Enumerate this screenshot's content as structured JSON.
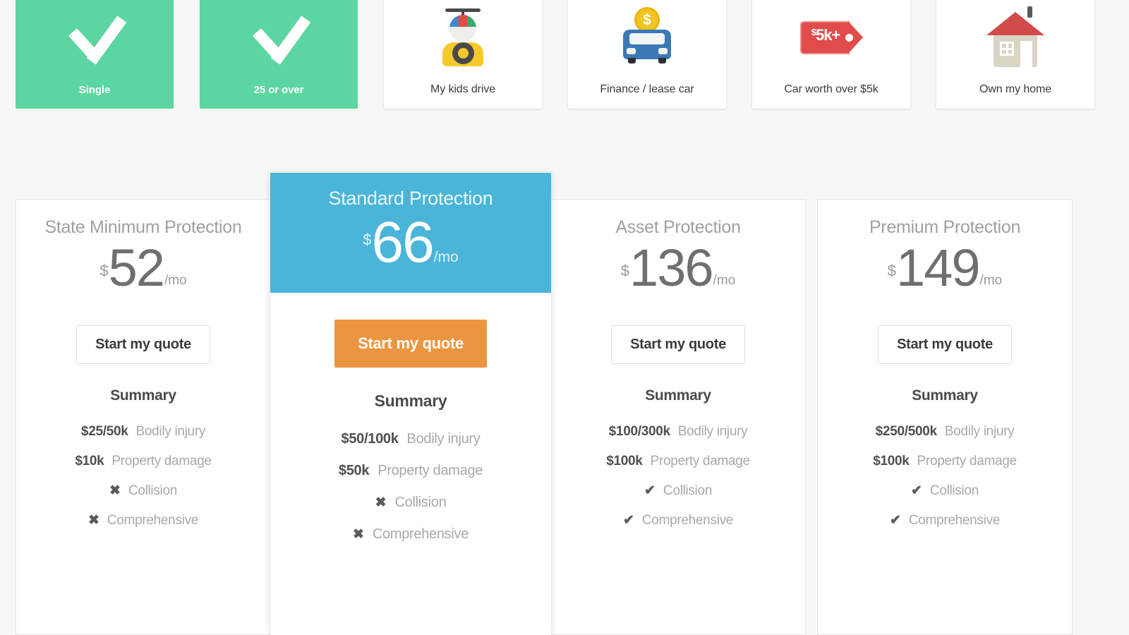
{
  "profile_tiles": [
    {
      "label": "Single",
      "icon": "check-icon",
      "selected": true
    },
    {
      "label": "25 or over",
      "icon": "check-icon",
      "selected": true
    },
    {
      "label": "My kids drive",
      "icon": "kid-driver-icon",
      "selected": false
    },
    {
      "label": "Finance / lease car",
      "icon": "financed-car-icon",
      "selected": false
    },
    {
      "label": "Car worth over $5k",
      "icon": "price-tag-5k-icon",
      "selected": false
    },
    {
      "label": "Own my home",
      "icon": "house-icon",
      "selected": false
    }
  ],
  "tag_icon_text": {
    "sup": "$",
    "main": "5k+"
  },
  "coin_symbol": "$",
  "currency_symbol": "$",
  "per_month": "/mo",
  "summary_heading": "Summary",
  "cta_label": "Start my quote",
  "glyphs": {
    "included": "✔",
    "excluded": "✖"
  },
  "colors": {
    "selected_tile": "#5bd6a0",
    "featured_header": "#4ab5d8",
    "primary_cta": "#ec9540",
    "page_background": "#f7f7f7"
  },
  "plans": [
    {
      "name": "State Minimum Protection",
      "price": "52",
      "featured": false,
      "summary": [
        {
          "value": "$25/50k",
          "label": "Bodily injury"
        },
        {
          "value": "$10k",
          "label": "Property damage"
        },
        {
          "value": "✖",
          "label": "Collision"
        },
        {
          "value": "✖",
          "label": "Comprehensive"
        }
      ]
    },
    {
      "name": "Standard Protection",
      "price": "66",
      "featured": true,
      "summary": [
        {
          "value": "$50/100k",
          "label": "Bodily injury"
        },
        {
          "value": "$50k",
          "label": "Property damage"
        },
        {
          "value": "✖",
          "label": "Collision"
        },
        {
          "value": "✖",
          "label": "Comprehensive"
        }
      ]
    },
    {
      "name": "Asset Protection",
      "price": "136",
      "featured": false,
      "summary": [
        {
          "value": "$100/300k",
          "label": "Bodily injury"
        },
        {
          "value": "$100k",
          "label": "Property damage"
        },
        {
          "value": "✔",
          "label": "Collision"
        },
        {
          "value": "✔",
          "label": "Comprehensive"
        }
      ]
    },
    {
      "name": "Premium Protection",
      "price": "149",
      "featured": false,
      "summary": [
        {
          "value": "$250/500k",
          "label": "Bodily injury"
        },
        {
          "value": "$100k",
          "label": "Property damage"
        },
        {
          "value": "✔",
          "label": "Collision"
        },
        {
          "value": "✔",
          "label": "Comprehensive"
        }
      ]
    }
  ]
}
